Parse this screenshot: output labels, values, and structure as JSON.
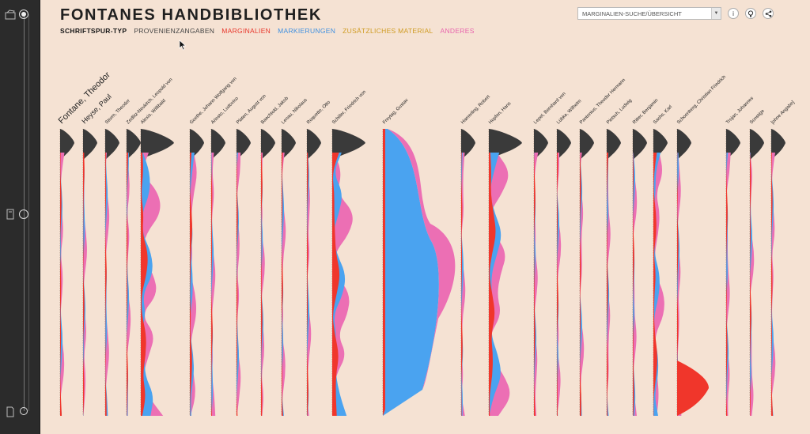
{
  "app": {
    "title": "FONTANES HANDBIBLIOTHEK"
  },
  "legend": {
    "items": [
      {
        "label": "SCHRIFTSPUR-TYP",
        "color": "#1a1a1a",
        "active": true
      },
      {
        "label": "PROVENIENZANGABEN",
        "color": "#444444"
      },
      {
        "label": "MARGINALIEN",
        "color": "#e8352a"
      },
      {
        "label": "MARKIERUNGEN",
        "color": "#3d8fe0"
      },
      {
        "label": "ZUSÄTZLICHES MATERIAL",
        "color": "#cf9b20"
      },
      {
        "label": "ANDERES",
        "color": "#e864ad"
      }
    ]
  },
  "controls": {
    "search_value": "MARGINALIEN-SUCHE/ÜBERSICHT",
    "info_icon": "info-icon",
    "lightbulb_icon": "lightbulb-icon",
    "share_icon": "share-icon"
  },
  "sidebar": {
    "icons": [
      "bookshelf-icon",
      "book-icon",
      "document-icon"
    ]
  },
  "colors": {
    "background": "#f5e2d3",
    "provenance": "#3a3a3a",
    "marginalia": "#f0362b",
    "markings": "#4aa3f0",
    "material": "#cf9b20",
    "other": "#ec6fb4"
  },
  "authors": [
    "Fontane, Theodor",
    "Heyse, Paul",
    "Storm, Theodor",
    "Zedlitz-Neukirch, Leopold von",
    "Alexis, Willibald",
    "Goethe, Johann Wolfgang von",
    "Ariosto, Ludovico",
    "Platen, August von",
    "Baechtold, Jakob",
    "Lenau, Nikolaus",
    "Roquette, Otto",
    "Schiller, Friedrich von",
    "Freytag, Gustav",
    "Hamerling, Robert",
    "Hopfen, Hans",
    "Lepel, Bernhard von",
    "Lübke, Wilhelm",
    "Pantenius, Theodor Hermann",
    "Pietsch, Ludwig",
    "Ritter, Benjamin",
    "Sachs, Karl",
    "Schoenberg, Christian Friedrich",
    "Trojan, Johannes",
    "Sonstige",
    "[ohne Angabe]"
  ]
}
